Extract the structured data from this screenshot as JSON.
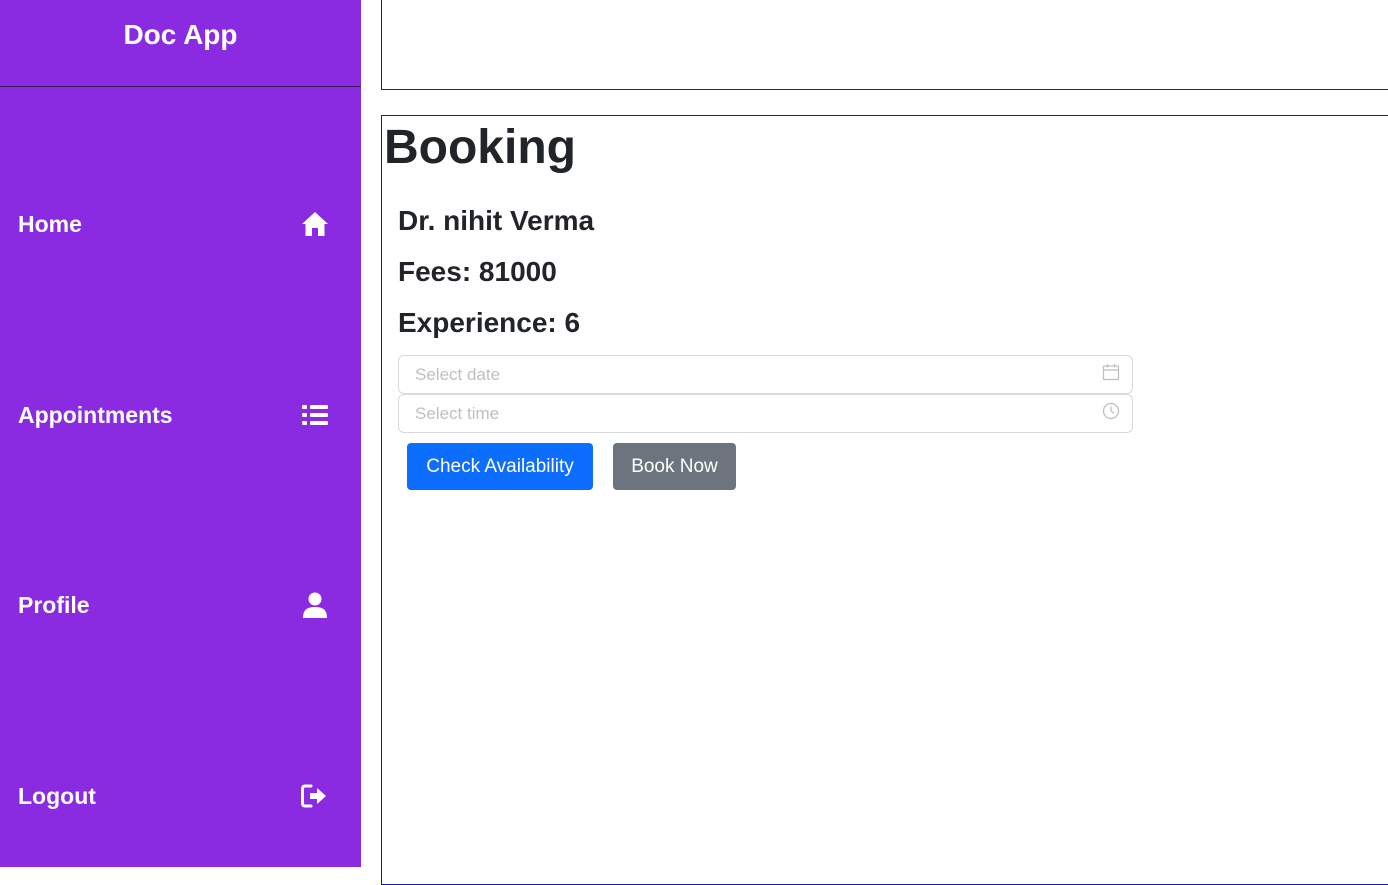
{
  "app": {
    "title": "Doc App"
  },
  "sidebar": {
    "items": [
      {
        "label": "Home",
        "icon": "home-icon"
      },
      {
        "label": "Appointments",
        "icon": "list-icon"
      },
      {
        "label": "Profile",
        "icon": "user-icon"
      },
      {
        "label": "Logout",
        "icon": "logout-icon"
      }
    ]
  },
  "booking": {
    "title": "Booking",
    "doctor_name": "Dr. nihit Verma",
    "fees": "Fees: 81000",
    "experience": "Experience: 6",
    "date_field": {
      "placeholder": "Select date",
      "value": "",
      "icon": "calendar-icon"
    },
    "time_field": {
      "placeholder": "Select time",
      "value": "",
      "icon": "clock-icon"
    },
    "check_button": "Check Availability",
    "book_button": "Book Now"
  },
  "colors": {
    "sidebar_bg": "#8a2be2",
    "primary": "#0d6efd",
    "secondary": "#6c757d",
    "border": "#1a1aa0"
  }
}
